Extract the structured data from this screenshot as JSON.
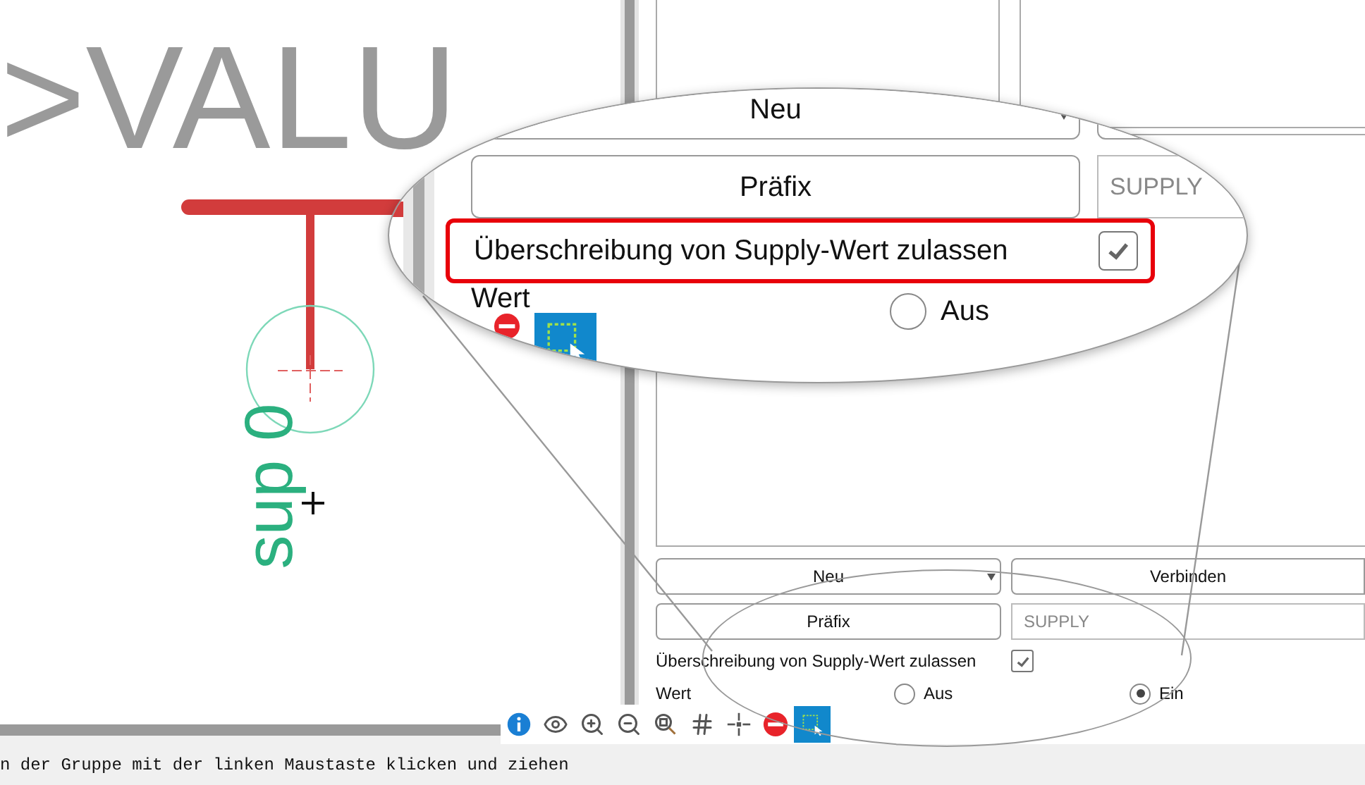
{
  "canvas": {
    "value_label": ">VALU",
    "symbol_label": "sup 0"
  },
  "form": {
    "type_dropdown": "Neu",
    "connect_button": "Verbinden",
    "prefix_button": "Präfix",
    "prefix_field": {
      "value": "SUPPLY",
      "disabled": true
    },
    "override": {
      "label": "Überschreibung von Supply-Wert zulassen",
      "checked": true
    },
    "value_label": "Wert",
    "value_options": [
      {
        "label": "Aus",
        "selected": false
      },
      {
        "label": "Ein",
        "selected": true
      }
    ]
  },
  "toolbar": [
    {
      "kind": "info",
      "selected": false
    },
    {
      "kind": "eye",
      "selected": false
    },
    {
      "kind": "zoom-in",
      "selected": false
    },
    {
      "kind": "zoom-out",
      "selected": false
    },
    {
      "kind": "zoom-fit",
      "selected": false
    },
    {
      "kind": "grid",
      "selected": false
    },
    {
      "kind": "crosshair",
      "selected": false
    },
    {
      "kind": "stop",
      "selected": false
    },
    {
      "kind": "select",
      "selected": true
    }
  ],
  "magnifier": {
    "type_dropdown": "Neu",
    "prefix_button": "Präfix",
    "prefix_field": {
      "value": "SUPPLY",
      "disabled": true
    },
    "override": {
      "label": "Überschreibung von Supply-Wert zulassen",
      "checked": true,
      "highlighted": true
    },
    "value_label": "Wert",
    "value_options": [
      {
        "label": "Aus",
        "selected": false
      }
    ],
    "tools": [
      {
        "kind": "stop",
        "selected": false
      },
      {
        "kind": "select",
        "selected": true
      }
    ]
  },
  "status_bar": "n der Gruppe mit der linken Maustaste klicken und ziehen"
}
